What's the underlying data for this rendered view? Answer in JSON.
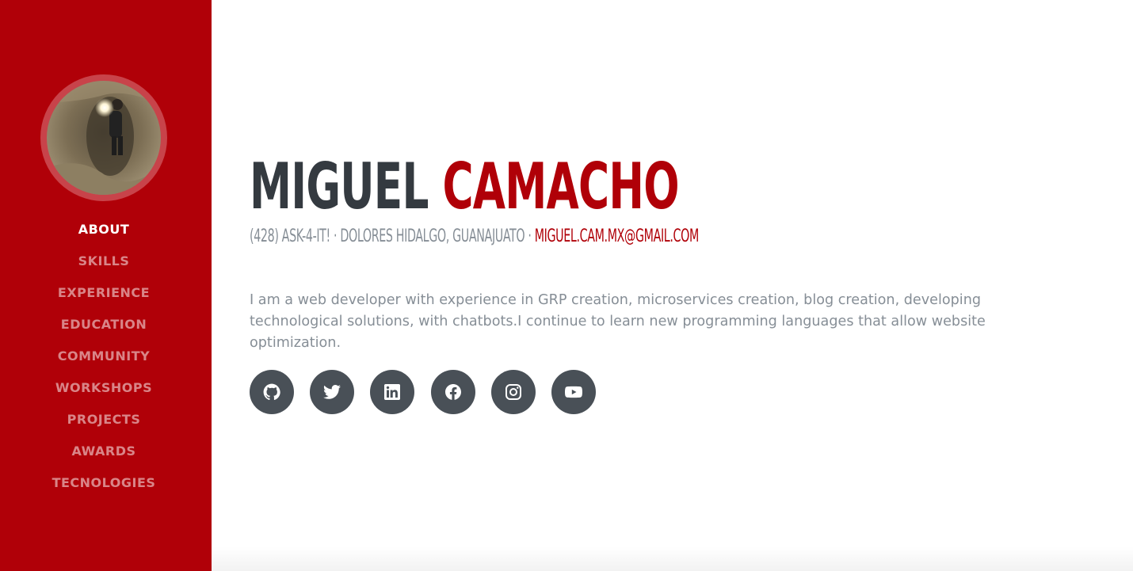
{
  "sidebar": {
    "avatar_alt": "profile photo",
    "nav": [
      {
        "label": "ABOUT",
        "active": true
      },
      {
        "label": "SKILLS",
        "active": false
      },
      {
        "label": "EXPERIENCE",
        "active": false
      },
      {
        "label": "EDUCATION",
        "active": false
      },
      {
        "label": "COMMUNITY",
        "active": false
      },
      {
        "label": "WORKSHOPS",
        "active": false
      },
      {
        "label": "PROJECTS",
        "active": false
      },
      {
        "label": "AWARDS",
        "active": false
      },
      {
        "label": "TECNOLOGIES",
        "active": false
      }
    ]
  },
  "header": {
    "first_name": "MIGUEL",
    "last_name": "CAMACHO"
  },
  "contact": {
    "phone": "(428) ASK-4-IT!",
    "separator": " · ",
    "location": "DOLORES HIDALGO, GUANAJUATO",
    "email": "MIGUEL.CAM.MX@GMAIL.COM"
  },
  "bio": "I am a web developer with experience in GRP creation, microservices creation, blog creation, developing technological solutions, with chatbots.I continue to learn new programming languages that allow website optimization.",
  "social": [
    {
      "icon": "github-icon"
    },
    {
      "icon": "twitter-icon"
    },
    {
      "icon": "linkedin-icon"
    },
    {
      "icon": "facebook-icon"
    },
    {
      "icon": "instagram-icon"
    },
    {
      "icon": "youtube-icon"
    }
  ],
  "colors": {
    "sidebar_bg": "#b00008",
    "accent": "#b00008",
    "heading_dark": "#343a40",
    "muted_text": "#868e96",
    "social_bg": "#495057"
  }
}
